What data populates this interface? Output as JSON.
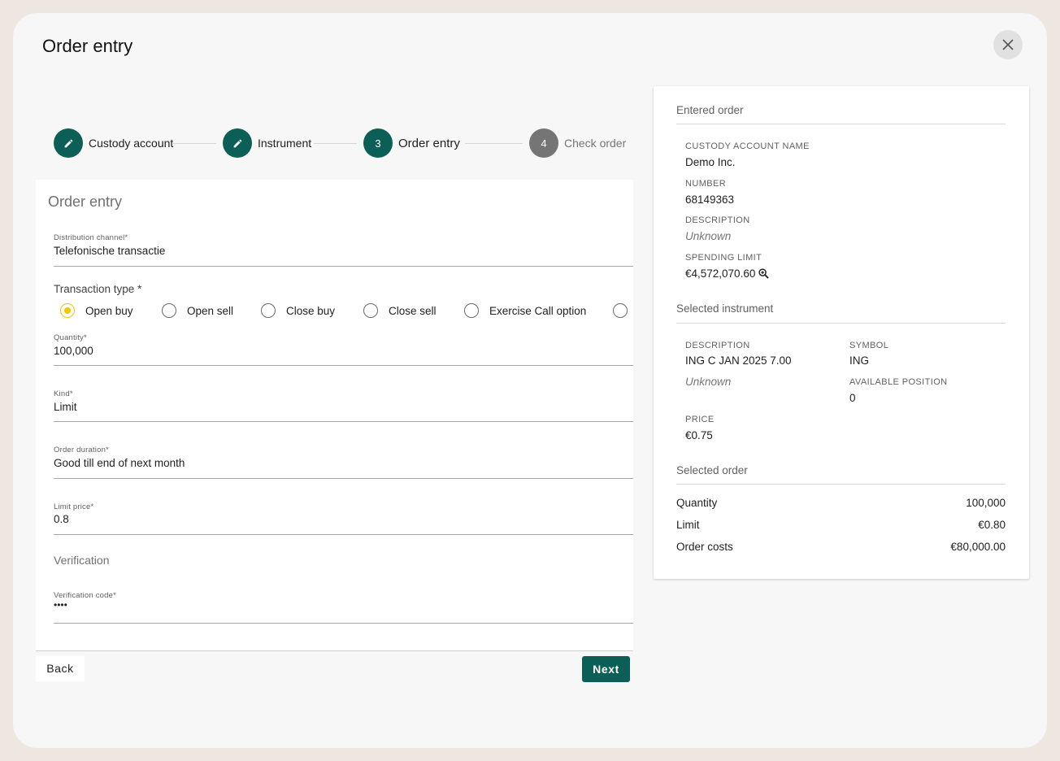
{
  "dialog": {
    "title": "Order entry",
    "close_icon": "close-icon"
  },
  "stepper": {
    "steps": [
      {
        "number": "",
        "label": "Custody account",
        "state": "done",
        "icon": "pencil-icon"
      },
      {
        "number": "",
        "label": "Instrument",
        "state": "done",
        "icon": "pencil-icon"
      },
      {
        "number": "3",
        "label": "Order entry",
        "state": "active"
      },
      {
        "number": "4",
        "label": "Check order",
        "state": "todo"
      }
    ]
  },
  "form": {
    "title": "Order entry",
    "distribution_channel": {
      "label": "Distribution channel*",
      "value": "Telefonische transactie"
    },
    "transaction_type": {
      "label": "Transaction type *",
      "options": [
        "Open buy",
        "Open sell",
        "Close buy",
        "Close sell",
        "Exercise Call option",
        ""
      ],
      "selected": "Open buy"
    },
    "quantity": {
      "label": "Quantity*",
      "value": "100,000"
    },
    "kind": {
      "label": "Kind*",
      "value": "Limit"
    },
    "order_duration": {
      "label": "Order duration*",
      "value": "Good till end of next month"
    },
    "limit_price": {
      "label": "Limit price*",
      "value": "0.8"
    },
    "verification": {
      "title": "Verification",
      "code_label": "Verification code*",
      "code_value": "••••"
    },
    "back_label": "Back",
    "next_label": "Next"
  },
  "summary": {
    "entered_order": {
      "title": "Entered order",
      "custody_account_name_label": "CUSTODY ACCOUNT NAME",
      "custody_account_name": "Demo Inc.",
      "number_label": "NUMBER",
      "number": "68149363",
      "description_label": "DESCRIPTION",
      "description": "Unknown",
      "spending_limit_label": "SPENDING LIMIT",
      "spending_limit": "€4,572,070.60"
    },
    "selected_instrument": {
      "title": "Selected instrument",
      "description_label": "DESCRIPTION",
      "description": "ING C JAN 2025 7.00",
      "description_sub": "Unknown",
      "symbol_label": "SYMBOL",
      "symbol": "ING",
      "available_position_label": "AVAILABLE POSITION",
      "available_position": "0",
      "price_label": "PRICE",
      "price": "€0.75"
    },
    "selected_order": {
      "title": "Selected order",
      "rows": [
        {
          "label": "Quantity",
          "value": "100,000"
        },
        {
          "label": "Limit",
          "value": "€0.80"
        },
        {
          "label": "Order costs",
          "value": "€80,000.00"
        }
      ]
    }
  },
  "colors": {
    "primary": "#0b5f56",
    "radio_selected": "#f5c400",
    "step_todo": "#757575",
    "background": "#ede7e0"
  }
}
